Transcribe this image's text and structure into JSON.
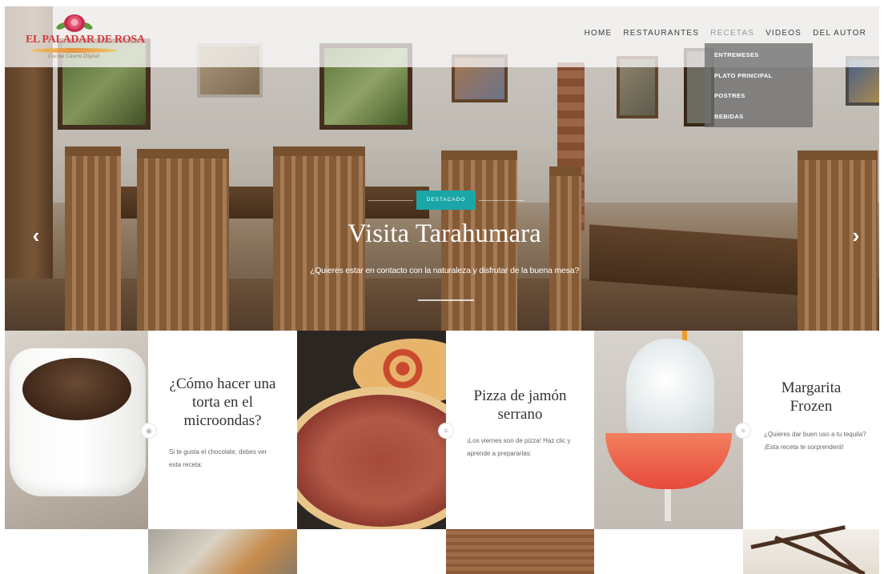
{
  "brand": {
    "name": "EL PALADAR DE ROSA",
    "tagline": "Cocina Casera Digital"
  },
  "nav": {
    "items": [
      "HOME",
      "RESTAURANTES",
      "RECETAS",
      "VIDEOS",
      "DEL AUTOR"
    ],
    "active": "RECETAS",
    "dropdown": [
      "ENTREMESES",
      "PLATO PRINCIPAL",
      "POSTRES",
      "BEBIDAS"
    ]
  },
  "slider": {
    "badge": "DESTACADO",
    "title": "Visita Tarahumara",
    "subtitle": "¿Quieres estar en contacto con la naturaleza y disfrutar de la buena mesa?",
    "prev_icon": "chevron-left-icon",
    "next_icon": "chevron-right-icon"
  },
  "cards": [
    {
      "title": "¿Cómo hacer una torta en el microondas?",
      "desc": "Si te gusta el chocolate, debes ver esta receta:",
      "icon": "camera-icon"
    },
    {
      "title": "Pizza de jamón serrano",
      "desc": "¡Los viernes son de pizza! Haz clic y aprende a prepararlas:",
      "icon": "document-icon"
    },
    {
      "title": "Margarita Frozen",
      "desc": "¿Quieres dar buen uso a tu tequila? ¡Esta receta te sorprenderá!",
      "icon": "document-icon"
    }
  ],
  "colors": {
    "accent": "#1aa6a8",
    "logo_red": "#d43a3a",
    "dropdown_bg": "#6e6e6e"
  }
}
